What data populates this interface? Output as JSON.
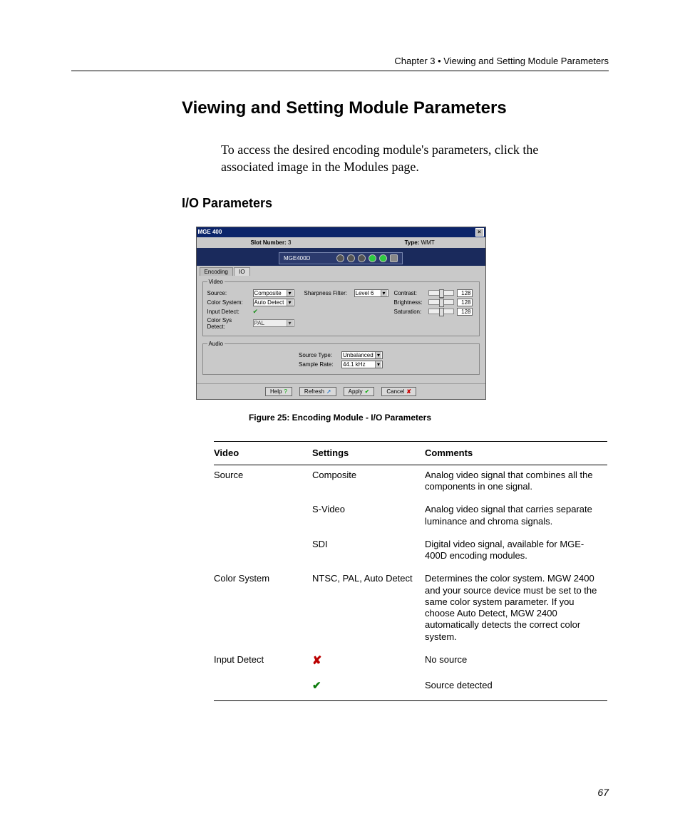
{
  "header": {
    "chapter": "Chapter 3 • Viewing and Setting Module Parameters"
  },
  "title": "Viewing and Setting Module Parameters",
  "intro": "To access the desired encoding module's parameters, click the associated image in the Modules page.",
  "section": "I/O Parameters",
  "figure_caption": "Figure 25: Encoding Module - I/O Parameters",
  "page_number": "67",
  "win": {
    "title": "MGE 400",
    "slot_label": "Slot Number:",
    "slot_value": "3",
    "type_label": "Type:",
    "type_value": "WMT",
    "device_name": "MGE400D",
    "tabs": {
      "encoding": "Encoding",
      "io": "IO"
    },
    "video_legend": "Video",
    "audio_legend": "Audio",
    "labels": {
      "source": "Source:",
      "color_system": "Color System:",
      "input_detect": "Input Detect:",
      "color_sys_detect": "Color Sys Detect:",
      "sharpness": "Sharpness Filter:",
      "contrast": "Contrast:",
      "brightness": "Brightness:",
      "saturation": "Saturation:",
      "source_type": "Source Type:",
      "sample_rate": "Sample Rate:"
    },
    "values": {
      "source": "Composite",
      "color_system": "Auto Detect",
      "color_sys_detect": "PAL",
      "sharpness": "Level 6",
      "contrast": "128",
      "brightness": "128",
      "saturation": "128",
      "source_type": "Unbalanced",
      "sample_rate": "44.1 kHz"
    },
    "buttons": {
      "help": "Help",
      "refresh": "Refresh",
      "apply": "Apply",
      "cancel": "Cancel"
    }
  },
  "table": {
    "headers": {
      "c1": "Video",
      "c2": "Settings",
      "c3": "Comments"
    },
    "rows": [
      {
        "c1": "Source",
        "c2": "Composite",
        "c3": "Analog video signal that combines all the components in one signal."
      },
      {
        "c1": "",
        "c2": "S-Video",
        "c3": "Analog video signal that carries separate luminance and chroma signals."
      },
      {
        "c1": "",
        "c2": "SDI",
        "c3": "Digital video signal, available for MGE-400D encoding modules."
      },
      {
        "c1": "Color System",
        "c2": "NTSC, PAL, Auto Detect",
        "c3": "Determines the color system. MGW 2400 and your source device must be set to the same color system parameter. If you choose Auto Detect, MGW 2400 automatically detects the correct color system."
      },
      {
        "c1": "Input Detect",
        "c2": "__X__",
        "c3": "No source"
      },
      {
        "c1": "",
        "c2": "__V__",
        "c3": "Source detected"
      }
    ]
  }
}
